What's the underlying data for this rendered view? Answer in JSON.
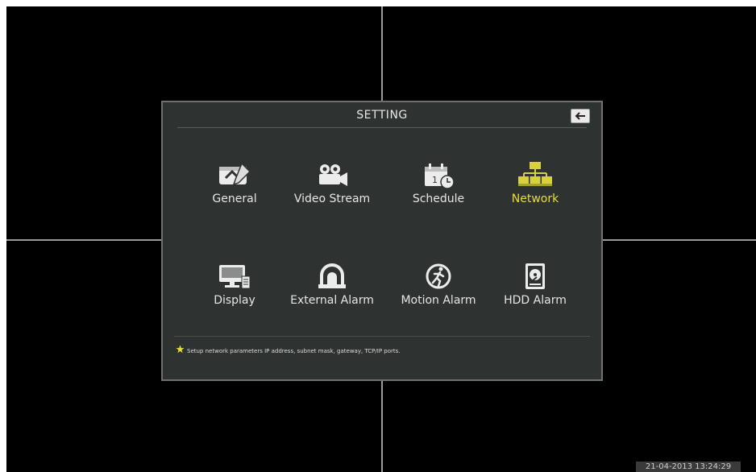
{
  "dialog": {
    "title": "SETTING",
    "back_icon": "back-arrow-icon",
    "items": [
      {
        "label": "General",
        "icon": "general-settings-icon",
        "selected": false
      },
      {
        "label": "Video Stream",
        "icon": "video-camera-icon",
        "selected": false
      },
      {
        "label": "Schedule",
        "icon": "calendar-clock-icon",
        "selected": false
      },
      {
        "label": "Network",
        "icon": "network-tree-icon",
        "selected": true
      },
      {
        "label": "Display",
        "icon": "monitor-icon",
        "selected": false
      },
      {
        "label": "External Alarm",
        "icon": "alarm-siren-icon",
        "selected": false
      },
      {
        "label": "Motion Alarm",
        "icon": "running-man-icon",
        "selected": false
      },
      {
        "label": "HDD Alarm",
        "icon": "hard-disk-icon",
        "selected": false
      }
    ],
    "hint": "Setup network parameters IP address, subnet mask, gateway, TCP/IP ports."
  },
  "status": {
    "datetime": "21-04-2013 13:24:29"
  },
  "colors": {
    "selected_label": "#e6df3a",
    "icon_selected": "#d8d23a",
    "dialog_bg": "#2e3230"
  }
}
